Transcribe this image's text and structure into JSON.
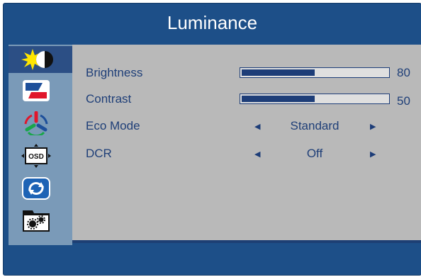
{
  "menu": {
    "title": "Luminance",
    "sidebar": [
      {
        "icon": "luminance-icon"
      },
      {
        "icon": "image-setup-icon"
      },
      {
        "icon": "color-setup-icon"
      },
      {
        "icon": "osd-setup-icon"
      },
      {
        "icon": "reset-icon"
      },
      {
        "icon": "extra-settings-icon"
      }
    ],
    "rows": {
      "brightness": {
        "label": "Brightness",
        "value": "80",
        "level": 0.5
      },
      "contrast": {
        "label": "Contrast",
        "value": "50",
        "level": 0.5
      },
      "eco_mode": {
        "label": "Eco Mode",
        "value": "Standard"
      },
      "dcr": {
        "label": "DCR",
        "value": "Off"
      }
    }
  },
  "colors": {
    "frame": "#1d4f88",
    "content": "#b9b9b9",
    "sidebar": "#7a9ab8",
    "text": "#1f3f78"
  }
}
